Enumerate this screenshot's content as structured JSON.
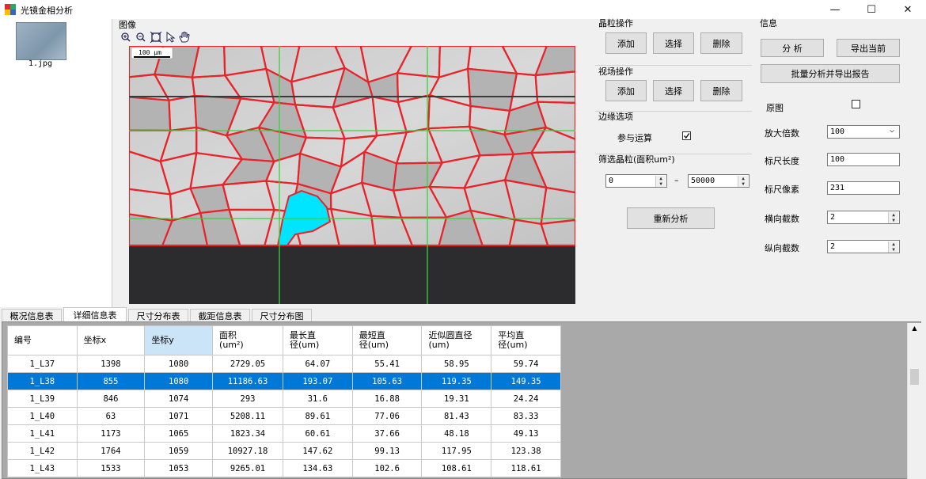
{
  "window": {
    "title": "光镜金相分析",
    "min": "—",
    "max": "☐",
    "close": "✕"
  },
  "thumbnail": {
    "name": "1.jpg"
  },
  "image_panel": {
    "title": "图像",
    "scale_label": "100 μm",
    "toolbar": [
      "zoom-in-icon",
      "zoom-out-icon",
      "fit-icon",
      "select-arrow-icon",
      "pan-hand-icon"
    ]
  },
  "grain_ops": {
    "title": "晶粒操作",
    "add": "添加",
    "select": "选择",
    "delete": "删除"
  },
  "field_ops": {
    "title": "视场操作",
    "add": "添加",
    "select": "选择",
    "delete": "删除"
  },
  "edge": {
    "title": "边缘选项",
    "participate": "参与运算",
    "checked": true
  },
  "filter": {
    "title": "筛选晶粒(面积um²)",
    "min": "0",
    "dash": "–",
    "max": "50000"
  },
  "reanalyze": "重新分析",
  "info": {
    "title": "信息",
    "analyze": "分 析",
    "export_current": "导出当前",
    "batch": "批量分析并导出报告",
    "original_label": "原图",
    "original_checked": false,
    "mag_label": "放大倍数",
    "mag_value": "100",
    "ruler_len_label": "标尺长度",
    "ruler_len_value": "100",
    "ruler_px_label": "标尺像素",
    "ruler_px_value": "231",
    "h_cut_label": "横向截数",
    "h_cut_value": "2",
    "v_cut_label": "纵向截数",
    "v_cut_value": "2"
  },
  "tabs": [
    "概况信息表",
    "详细信息表",
    "尺寸分布表",
    "截距信息表",
    "尺寸分布图"
  ],
  "active_tab": 1,
  "table": {
    "headers": [
      "编号",
      "坐标x",
      "坐标y",
      "面积\n(um²)",
      "最长直\n径(um)",
      "最短直\n径(um)",
      "近似圆直径\n(um)",
      "平均直\n径(um)"
    ],
    "rows": [
      [
        "1_L37",
        "1398",
        "1080",
        "2729.05",
        "64.07",
        "55.41",
        "58.95",
        "59.74"
      ],
      [
        "1_L38",
        "855",
        "1080",
        "11186.63",
        "193.07",
        "105.63",
        "119.35",
        "149.35"
      ],
      [
        "1_L39",
        "846",
        "1074",
        "293",
        "31.6",
        "16.88",
        "19.31",
        "24.24"
      ],
      [
        "1_L40",
        "63",
        "1071",
        "5208.11",
        "89.61",
        "77.06",
        "81.43",
        "83.33"
      ],
      [
        "1_L41",
        "1173",
        "1065",
        "1823.34",
        "60.61",
        "37.66",
        "48.18",
        "49.13"
      ],
      [
        "1_L42",
        "1764",
        "1059",
        "10927.18",
        "147.62",
        "99.13",
        "117.95",
        "123.38"
      ],
      [
        "1_L43",
        "1533",
        "1053",
        "9265.01",
        "134.63",
        "102.6",
        "108.61",
        "118.61"
      ]
    ],
    "selected_row": 1,
    "sorted_col": 2
  },
  "colors": {
    "accent": "#0078d7",
    "grain_boundary": "#e8242a",
    "highlight_grain": "#00e5ff",
    "grid_line": "#3ad13a"
  }
}
